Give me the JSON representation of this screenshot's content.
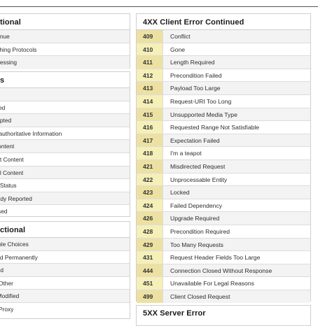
{
  "left_column": {
    "informational_rows": [
      "ntinue",
      "itching Protocols",
      "ocessing"
    ],
    "success": {
      "title": "s",
      "rows": [
        "",
        "ated",
        "cepted",
        "n-authoritative Information",
        "Content",
        "set Content",
        "tial Content",
        "lti-Status",
        "eady Reported",
        "Used"
      ]
    },
    "redirection": {
      "title": "ctional",
      "rows": [
        "ltiple Choices",
        "ved Permanently",
        "und",
        "e Other",
        "t Modified",
        "e Proxy"
      ]
    }
  },
  "informational_title": "tional",
  "client_error": {
    "title": "4XX Client Error Continued",
    "rows": [
      {
        "code": "409",
        "desc": "Conflict"
      },
      {
        "code": "410",
        "desc": "Gone"
      },
      {
        "code": "411",
        "desc": "Length Required"
      },
      {
        "code": "412",
        "desc": "Precondition Failed"
      },
      {
        "code": "413",
        "desc": "Payload Too Large"
      },
      {
        "code": "414",
        "desc": "Request-URI Too Long"
      },
      {
        "code": "415",
        "desc": "Unsupported Media Type"
      },
      {
        "code": "416",
        "desc": "Requested Range Not Satisfiable"
      },
      {
        "code": "417",
        "desc": "Expectation Failed"
      },
      {
        "code": "418",
        "desc": "I'm a teapot"
      },
      {
        "code": "421",
        "desc": "Misdirected Request"
      },
      {
        "code": "422",
        "desc": "Unprocessable Entity"
      },
      {
        "code": "423",
        "desc": "Locked"
      },
      {
        "code": "424",
        "desc": "Failed Dependency"
      },
      {
        "code": "426",
        "desc": "Upgrade Required"
      },
      {
        "code": "428",
        "desc": "Precondition Required"
      },
      {
        "code": "429",
        "desc": "Too Many Requests"
      },
      {
        "code": "431",
        "desc": "Request Header Fields Too Large"
      },
      {
        "code": "444",
        "desc": "Connection Closed Without Response"
      },
      {
        "code": "451",
        "desc": "Unavailable For Legal Reasons"
      },
      {
        "code": "499",
        "desc": "Client Closed Request"
      }
    ]
  },
  "server_error": {
    "title": "5XX Server Error"
  },
  "colors": {
    "code_cell": "#f5efb8",
    "code_cell_alt": "#ece1a2",
    "row_alt": "#f3f3f3",
    "border": "#cfcfcf"
  }
}
